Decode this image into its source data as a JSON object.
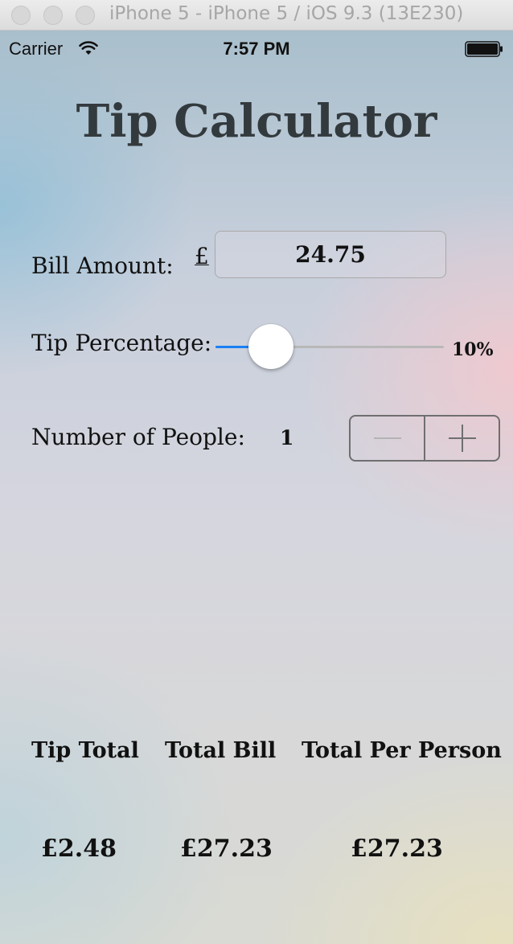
{
  "window": {
    "title": "iPhone 5 - iPhone 5 / iOS 9.3 (13E230)"
  },
  "status_bar": {
    "carrier": "Carrier",
    "time": "7:57 PM",
    "wifi_icon": "wifi-icon",
    "battery_icon": "battery-icon"
  },
  "app": {
    "title": "Tip Calculator"
  },
  "bill": {
    "label": "Bill Amount:",
    "currency_symbol": "£",
    "value": "24.75"
  },
  "tip": {
    "label": "Tip Percentage:",
    "percent_text": "10%",
    "slider_fraction": 0.18,
    "accent_color": "#1a7ff5"
  },
  "people": {
    "label": "Number of People:",
    "count": "1",
    "decrement_icon": "minus-icon",
    "increment_icon": "plus-icon"
  },
  "results": {
    "tip_total_label": "Tip Total",
    "total_bill_label": "Total Bill",
    "per_person_label": "Total Per Person",
    "tip_total_value": "£2.48",
    "total_bill_value": "£27.23",
    "per_person_value": "£27.23"
  }
}
